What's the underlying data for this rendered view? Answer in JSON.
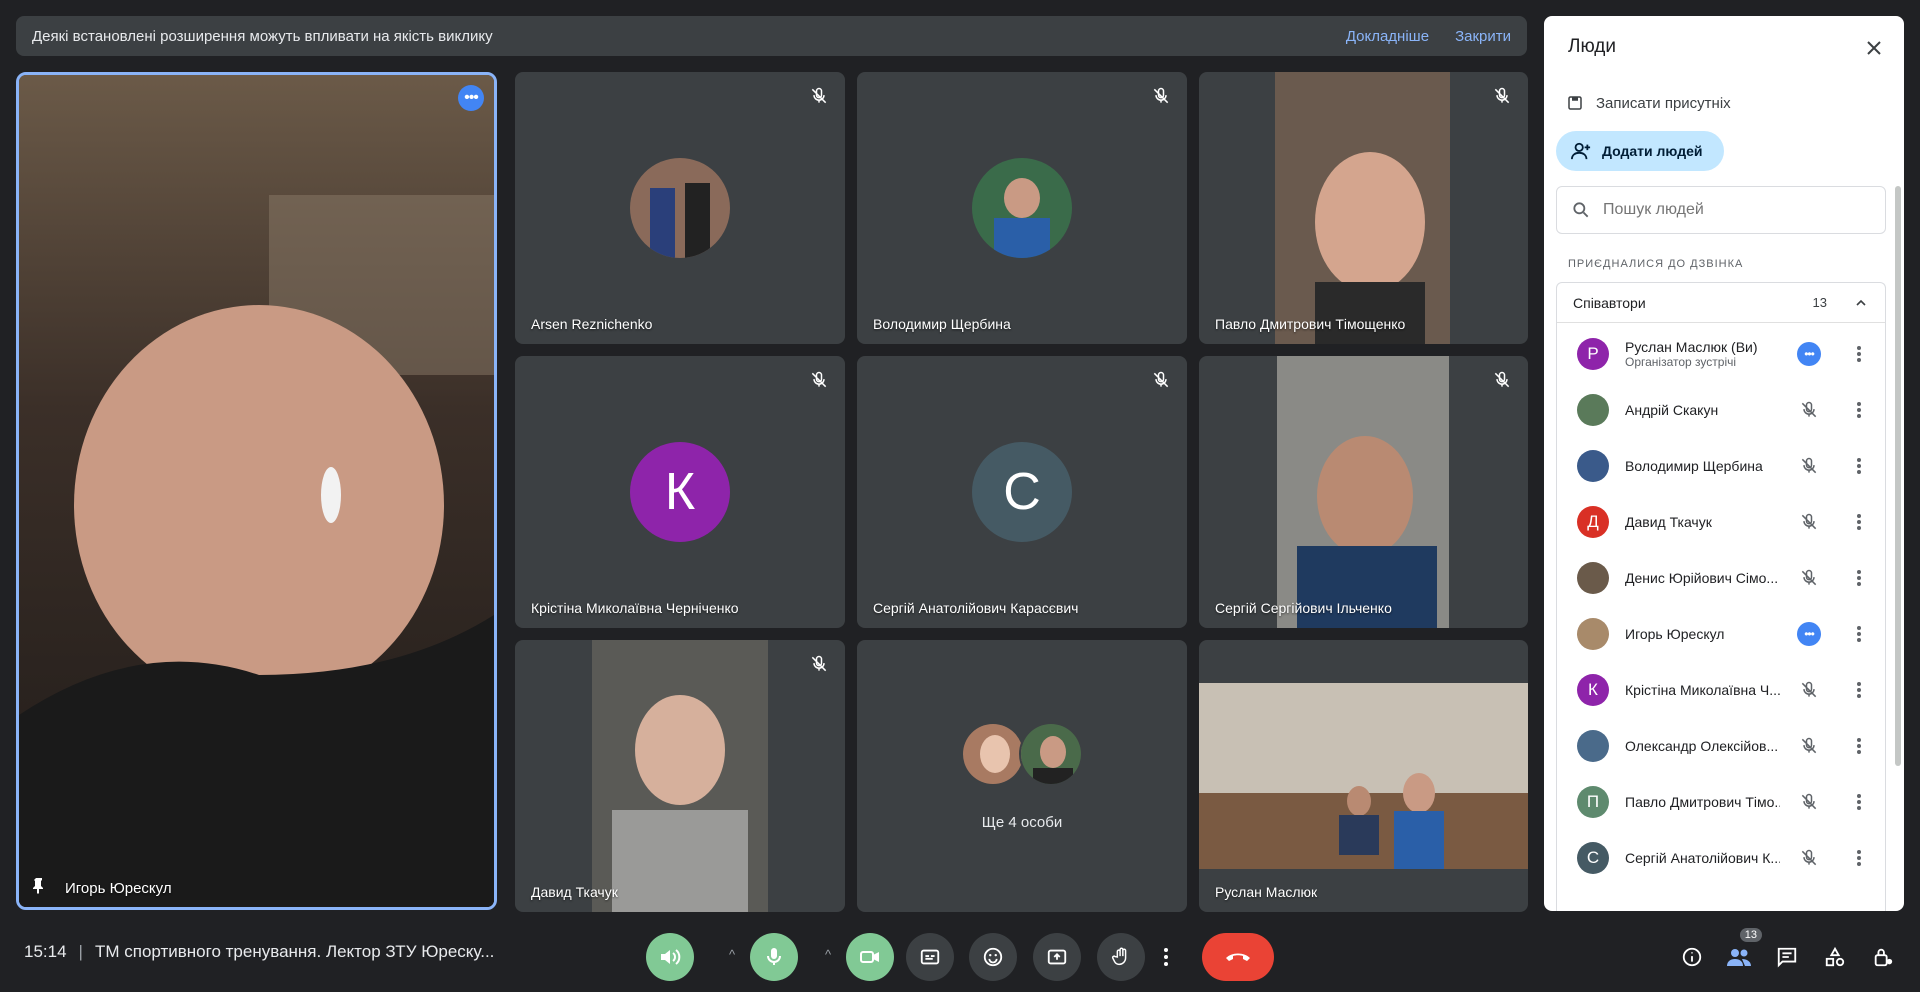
{
  "banner": {
    "message": "Деякі встановлені розширення можуть впливати на якість виклику",
    "learn_more": "Докладніше",
    "close": "Закрити"
  },
  "main_tile": {
    "name": "Игорь Юрескул"
  },
  "tiles": [
    {
      "name": "Arsen Reznichenko"
    },
    {
      "name": "Володимир Щербина"
    },
    {
      "name": "Павло Дмитрович Тімощенко"
    },
    {
      "name": "Крістіна Миколаївна Черніченко",
      "initial": "К"
    },
    {
      "name": "Сергій Анатолійович Карасєвич",
      "initial": "С"
    },
    {
      "name": "Сергій Сергійович Ільченко"
    },
    {
      "name": "Давид Ткачук"
    },
    {
      "name": "Ще 4 особи"
    },
    {
      "name": "Руслан Маслюк"
    }
  ],
  "bottom": {
    "time": "15:14",
    "meeting_title": "ТМ спортивного тренування. Лектор ЗТУ Юреску...",
    "people_count": "13"
  },
  "panel": {
    "title": "Люди",
    "record": "Записати присутніх",
    "add_people": "Додати людей",
    "search_placeholder": "Пошук людей",
    "section": "ПРИЄДНАЛИСЯ ДО ДЗВІНКА",
    "collaborators_label": "Співавтори",
    "collaborators_count": "13",
    "people": [
      {
        "name": "Руслан Маслюк (Ви)",
        "sub": "Організатор зустрічі",
        "initial": "Р",
        "color": "#8e24aa"
      },
      {
        "name": "Андрій Скакун"
      },
      {
        "name": "Володимир Щербина"
      },
      {
        "name": "Давид Ткачук",
        "initial": "Д",
        "color": "#d93025"
      },
      {
        "name": "Денис Юрійович Сімо..."
      },
      {
        "name": "Игорь Юрескул"
      },
      {
        "name": "Крістіна Миколаївна Ч...",
        "initial": "К",
        "color": "#8e24aa"
      },
      {
        "name": "Олександр Олексійов..."
      },
      {
        "name": "Павло Дмитрович Тімо...",
        "initial": "П",
        "color": "#5e8a6e"
      },
      {
        "name": "Сергій Анатолійович К...",
        "initial": "С",
        "color": "#455a64"
      }
    ]
  },
  "colors": {
    "accent": "#8ab4f8",
    "green": "#81c995",
    "red": "#ea4335",
    "blue": "#4285f4"
  }
}
